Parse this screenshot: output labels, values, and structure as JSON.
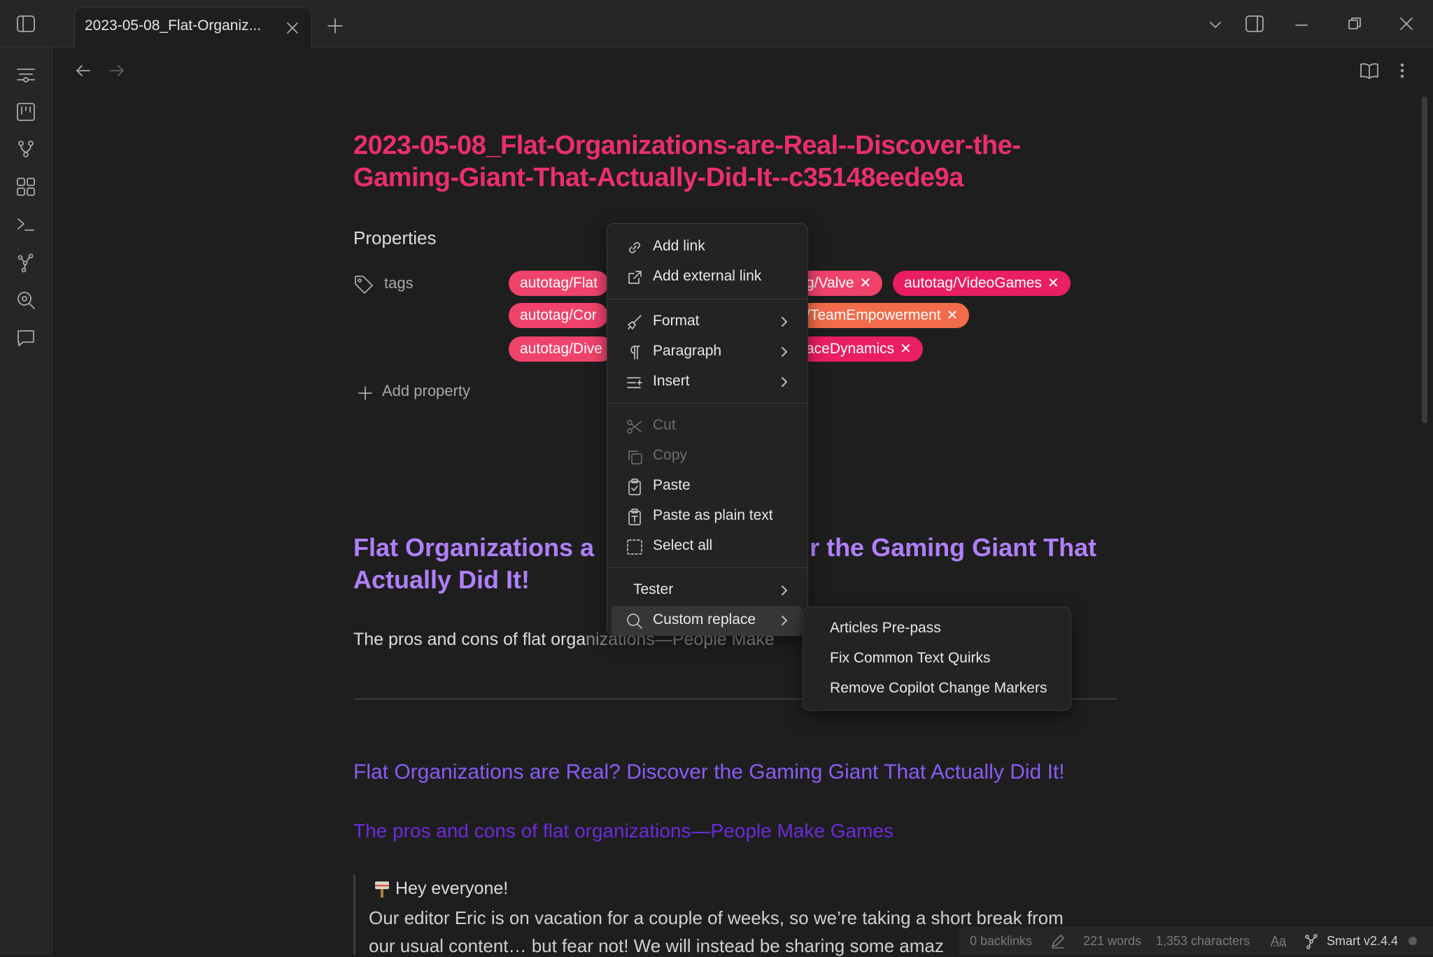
{
  "tab": {
    "title": "2023-05-08_Flat-Organiz..."
  },
  "note": {
    "title_line1": "2023-05-08_Flat-Organizations-are-Real--Discover-the-",
    "title_line2": "Gaming-Giant-That-Actually-Did-It--c35148eede9a",
    "properties_heading": "Properties",
    "tags_label": "tags",
    "tags": [
      {
        "text": "autotag/Flat",
        "color": "#f0436b"
      },
      {
        "text": "g/Valve",
        "color": "#f0436b"
      },
      {
        "text": "autotag/VideoGames",
        "color": "#e91e63"
      },
      {
        "text": "autotag/Cor",
        "color": "#f0436b"
      },
      {
        "text": "/TeamEmpowerment",
        "color": "#f26b4a"
      },
      {
        "text": "autotag/Dive",
        "color": "#f0436b"
      },
      {
        "text": "aceDynamics",
        "color": "#e91e63"
      }
    ],
    "add_property": "Add property",
    "heading_line1_left": "Flat Organizations a",
    "heading_line1_right": "r the Gaming Giant That",
    "heading_line2": "Actually Did It!",
    "intro_left": "The pros and cons of flat orga",
    "intro_right": "nizations—People Make",
    "link_title": "Flat Organizations are Real? Discover the Gaming Giant That Actually Did It!",
    "link_subtitle": "The pros and cons of flat organizations—People Make Games",
    "quote_line1": "Hey everyone!",
    "quote_line2": "Our editor Eric is on vacation for a couple of weeks, so we’re taking a short break from",
    "quote_line3": "our usual content… but fear not! We will instead be sharing some amaz"
  },
  "context_menu": {
    "add_link": "Add link",
    "add_external_link": "Add external link",
    "format": "Format",
    "paragraph": "Paragraph",
    "insert": "Insert",
    "cut": "Cut",
    "copy": "Copy",
    "paste": "Paste",
    "paste_plain": "Paste as plain text",
    "select_all": "Select all",
    "tester": "Tester",
    "custom_replace": "Custom replace"
  },
  "submenu": {
    "items": [
      "Articles Pre-pass",
      "Fix Common Text Quirks",
      "Remove Copilot Change Markers"
    ]
  },
  "status_bar": {
    "backlinks": "0 backlinks",
    "words": "221 words",
    "characters": "1,353 characters",
    "font_indicator": "Aa",
    "plugin": "Smart v2.4.4"
  }
}
